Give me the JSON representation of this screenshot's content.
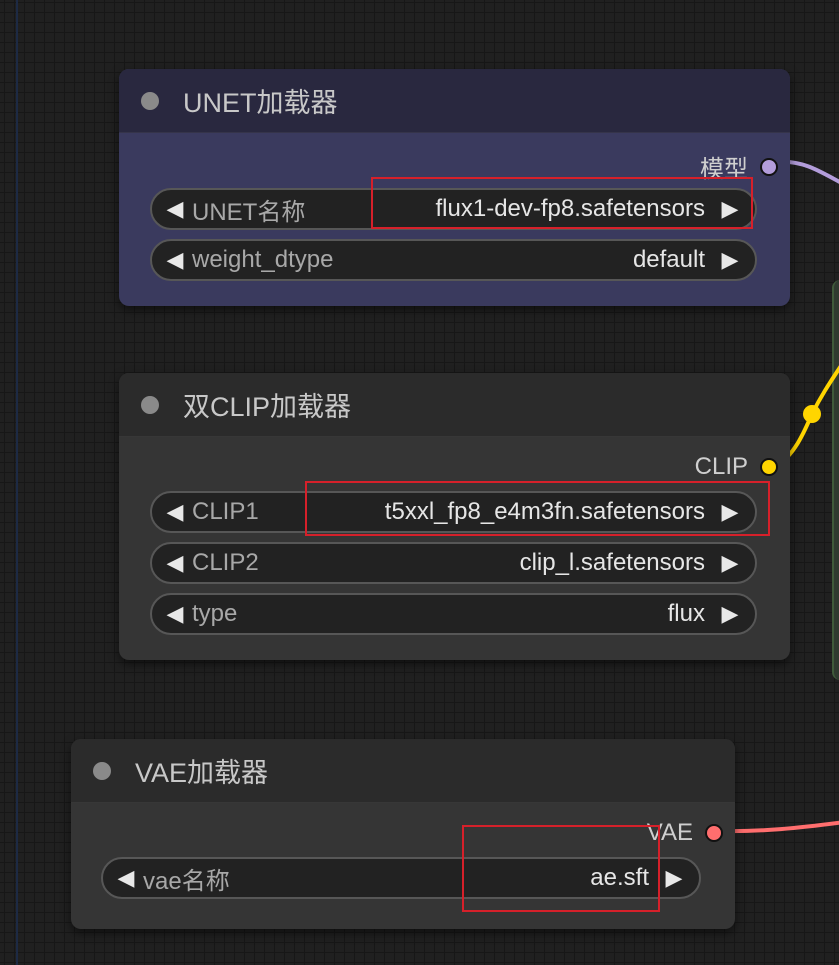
{
  "nodes": {
    "unet": {
      "title": "UNET加载器",
      "output": {
        "label": "模型",
        "color": "#b39ddb"
      },
      "widgets": [
        {
          "label": "UNET名称",
          "value": "flux1-dev-fp8.safetensors"
        },
        {
          "label": "weight_dtype",
          "value": "default"
        }
      ]
    },
    "clip": {
      "title": "双CLIP加载器",
      "output": {
        "label": "CLIP",
        "color": "#ffd500"
      },
      "widgets": [
        {
          "label": "CLIP1",
          "value": "t5xxl_fp8_e4m3fn.safetensors"
        },
        {
          "label": "CLIP2",
          "value": "clip_l.safetensors"
        },
        {
          "label": "type",
          "value": "flux"
        }
      ]
    },
    "vae": {
      "title": "VAE加载器",
      "output": {
        "label": "VAE",
        "color": "#ff6e6e"
      },
      "widgets": [
        {
          "label": "vae名称",
          "value": "ae.sft"
        }
      ]
    }
  },
  "icons": {
    "arrow_left": "◀",
    "arrow_right": "▶"
  },
  "colors": {
    "highlight": "#d6202a",
    "link_model": "#b39ddb",
    "link_clip": "#ffd500",
    "link_vae": "#ff6e6e"
  }
}
